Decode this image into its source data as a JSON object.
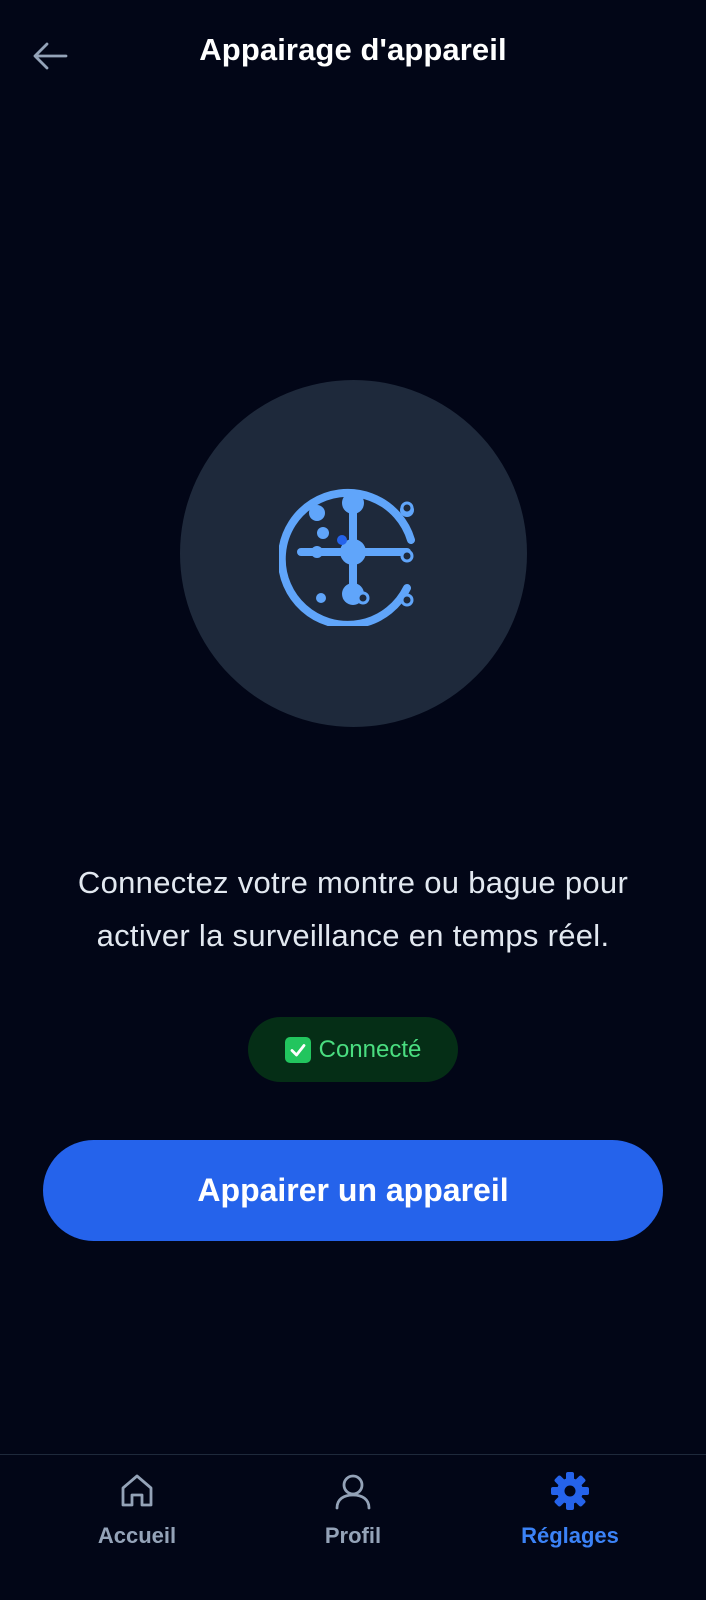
{
  "header": {
    "title": "Appairage d'appareil",
    "back_icon": "arrow-left-icon"
  },
  "device": {
    "icon": "device-sensor-icon",
    "description": "Connectez votre montre ou bague pour activer la surveillance en temps réel."
  },
  "status": {
    "icon": "check-mark-icon",
    "label": "Connecté",
    "color": "#4ade80",
    "background": "#052e16"
  },
  "actions": {
    "pair_label": "Appairer un appareil",
    "pair_color": "#2563eb"
  },
  "nav": {
    "items": [
      {
        "label": "Accueil",
        "icon": "home-icon",
        "active": false
      },
      {
        "label": "Profil",
        "icon": "user-icon",
        "active": false
      },
      {
        "label": "Réglages",
        "icon": "gear-icon",
        "active": true
      }
    ],
    "active_color": "#3b82f6",
    "inactive_color": "#94a3b8"
  },
  "colors": {
    "background": "#020617",
    "circle": "#1e293b",
    "icon_accent": "#60a5fa"
  }
}
